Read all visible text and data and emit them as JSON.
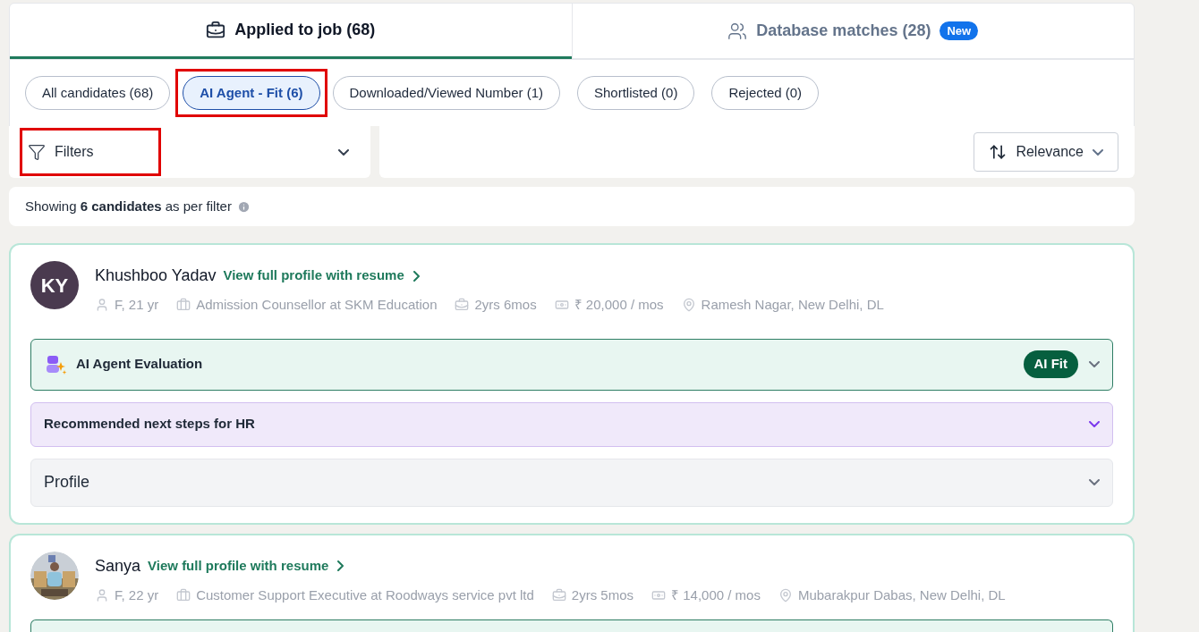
{
  "tabs": [
    {
      "label": "Applied to job (68)",
      "selected": true,
      "kind": "briefcase"
    },
    {
      "label": "Database matches (28)",
      "selected": false,
      "kind": "people",
      "badge": "New"
    }
  ],
  "chips": [
    {
      "label": "All candidates (68)",
      "selected": false,
      "highlighted": false
    },
    {
      "label": "AI Agent - Fit (6)",
      "selected": true,
      "highlighted": true
    },
    {
      "label": "Downloaded/Viewed Number (1)",
      "selected": false,
      "highlighted": false
    },
    {
      "label": "Shortlisted (0)",
      "selected": false,
      "highlighted": false
    },
    {
      "label": "Rejected (0)",
      "selected": false,
      "highlighted": false
    }
  ],
  "filters": {
    "label": "Filters",
    "highlighted": true
  },
  "sort": {
    "label": "Relevance"
  },
  "summary": "Showing **6 candidates** as per filter",
  "candidates": [
    {
      "name": "Khushboo Yadav",
      "avatar": {
        "kind": "initials",
        "text": "KY"
      },
      "link": "View full profile with resume",
      "meta": [
        {
          "kind": "person",
          "text": "F, 21 yr"
        },
        {
          "kind": "job",
          "text": "Admission Counsellor at SKM Education"
        },
        {
          "kind": "experience",
          "text": "2yrs 6mos"
        },
        {
          "kind": "salary",
          "text": "₹ 20,000 / mos"
        },
        {
          "kind": "location",
          "text": "Ramesh Nagar, New Delhi, DL"
        }
      ],
      "sections": [
        {
          "kind": "evaluation",
          "title": "AI Agent Evaluation",
          "badge": "AI Fit"
        },
        {
          "kind": "steps",
          "title": "Recommended next steps for HR"
        },
        {
          "kind": "profile",
          "title": "Profile"
        }
      ]
    },
    {
      "name": "Sanya",
      "avatar": {
        "kind": "picture"
      },
      "link": "View full profile with resume",
      "meta": [
        {
          "kind": "person",
          "text": "F, 22 yr"
        },
        {
          "kind": "job",
          "text": "Customer Support Executive at Roodways service pvt ltd"
        },
        {
          "kind": "experience",
          "text": "2yrs 5mos"
        },
        {
          "kind": "salary",
          "text": "₹ 14,000 / mos"
        },
        {
          "kind": "location",
          "text": "Mubarakpur Dabas, New Delhi, DL"
        }
      ],
      "sections": [
        {
          "kind": "evaluation"
        }
      ]
    }
  ]
}
